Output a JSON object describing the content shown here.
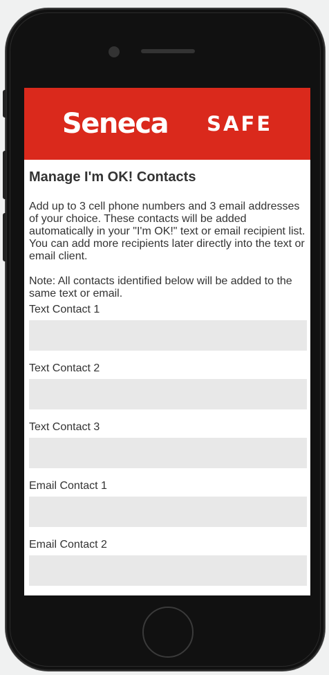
{
  "header": {
    "logo_text": "Seneca",
    "app_name": "SAFE",
    "brand_color": "#da291c"
  },
  "page": {
    "title": "Manage I'm OK! Contacts",
    "description": "Add up to 3 cell phone numbers and 3 email addresses of your choice. These contacts will be added automatically in your \"I'm OK!\" text or email recipient list. You can add more recipients later directly into the text or email client.",
    "note": "Note: All contacts identified below will be added to the same text or email."
  },
  "fields": [
    {
      "label": "Text Contact 1",
      "value": "",
      "placeholder": ""
    },
    {
      "label": "Text Contact 2",
      "value": "",
      "placeholder": ""
    },
    {
      "label": "Text Contact 3",
      "value": "",
      "placeholder": ""
    },
    {
      "label": "Email Contact 1",
      "value": "",
      "placeholder": ""
    },
    {
      "label": "Email Contact 2",
      "value": "",
      "placeholder": ""
    }
  ]
}
